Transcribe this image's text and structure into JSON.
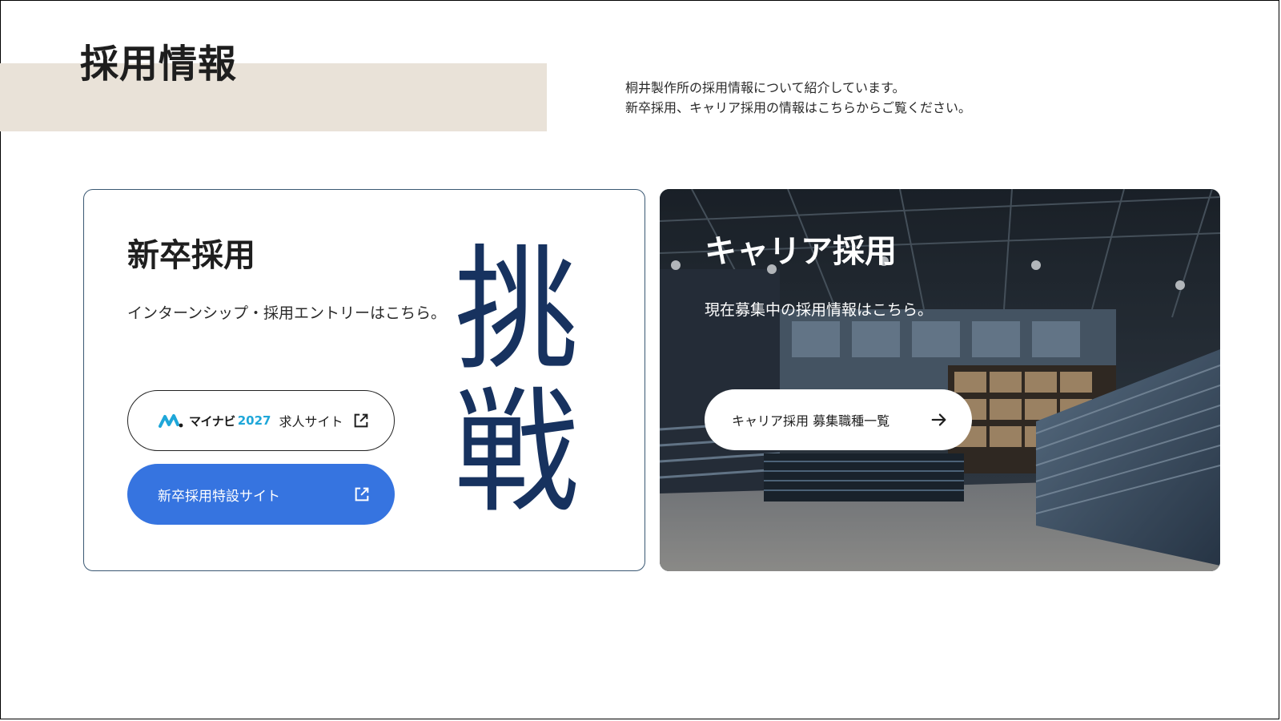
{
  "page": {
    "title": "採用情報",
    "intro_lines": [
      "桐井製作所の採用情報について紹介しています。",
      "新卒採用、キャリア採用の情報はこちらからご覧ください。"
    ]
  },
  "new_grad": {
    "title": "新卒採用",
    "description": "インターンシップ・採用エントリーはこちら。",
    "mynavi_button": {
      "brand": "マイナビ",
      "year": "2027",
      "label": "求人サイト",
      "icon": "external-link-icon"
    },
    "special_site_button": {
      "label": "新卒採用特設サイト",
      "icon": "external-link-icon"
    },
    "calligraphy": [
      "挑",
      "戦"
    ]
  },
  "career": {
    "title": "キャリア採用",
    "description": "現在募集中の採用情報はこちら。",
    "button": {
      "label": "キャリア採用 募集職種一覧",
      "icon": "arrow-right-icon"
    }
  },
  "colors": {
    "title_band": "#e9e2d8",
    "accent_blue": "#3674e0",
    "card_border": "#3a5873",
    "calligraphy": "#17325f",
    "mynavi_cyan": "#1fa7d9"
  }
}
